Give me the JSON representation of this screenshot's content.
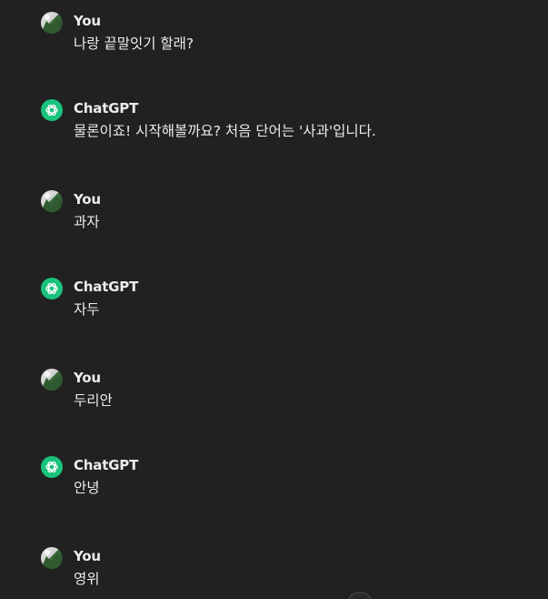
{
  "messages": [
    {
      "role": "user",
      "author": "You",
      "text": "나랑 끝말잇기 할래?"
    },
    {
      "role": "assistant",
      "author": "ChatGPT",
      "text": "물론이죠! 시작해볼까요? 처음 단어는 '사과'입니다."
    },
    {
      "role": "user",
      "author": "You",
      "text": "과자"
    },
    {
      "role": "assistant",
      "author": "ChatGPT",
      "text": "자두"
    },
    {
      "role": "user",
      "author": "You",
      "text": "두리안"
    },
    {
      "role": "assistant",
      "author": "ChatGPT",
      "text": "안녕"
    },
    {
      "role": "user",
      "author": "You",
      "text": "영위"
    }
  ],
  "icons": {
    "user_avatar": "user-avatar-icon",
    "assistant_avatar": "openai-logo-icon",
    "scroll_down": "scroll-down-icon"
  },
  "colors": {
    "background": "#212121",
    "text": "#ececec",
    "assistant_avatar_bg": "#19c37d"
  }
}
